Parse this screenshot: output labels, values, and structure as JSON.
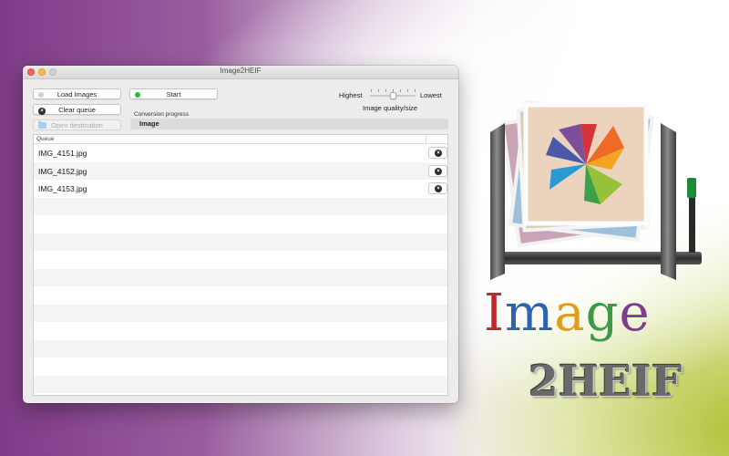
{
  "window": {
    "title": "Image2HEIF"
  },
  "toolbar": {
    "load_label": "Load Images",
    "clear_label": "Clear queue",
    "open_label": "Open destination",
    "start_label": "Start"
  },
  "progress": {
    "label": "Conversion progress",
    "text": "Image"
  },
  "quality": {
    "highest_label": "Highest",
    "lowest_label": "Lowest",
    "caption": "Image quality/size",
    "level": 0.5
  },
  "queue": {
    "header": "Queue",
    "items": [
      {
        "name": "IMG_4151.jpg"
      },
      {
        "name": "IMG_4152.jpg"
      },
      {
        "name": "IMG_4153.jpg"
      }
    ]
  },
  "branding": {
    "word_letters": [
      "I",
      "m",
      "a",
      "g",
      "e"
    ],
    "word_colors": [
      "#c2272d",
      "#2e63b0",
      "#e39a1e",
      "#3a9a45",
      "#7a3f8e"
    ],
    "sub": "2HEIF"
  },
  "colors": {
    "accent_green": "#27c03c",
    "close": "#fc605c",
    "minimize": "#fdbc40"
  },
  "icons": {
    "load": "grey-dot-icon",
    "clear": "x-circle-icon",
    "open": "folder-icon",
    "start": "green-dot-icon",
    "remove": "x-circle-icon"
  }
}
